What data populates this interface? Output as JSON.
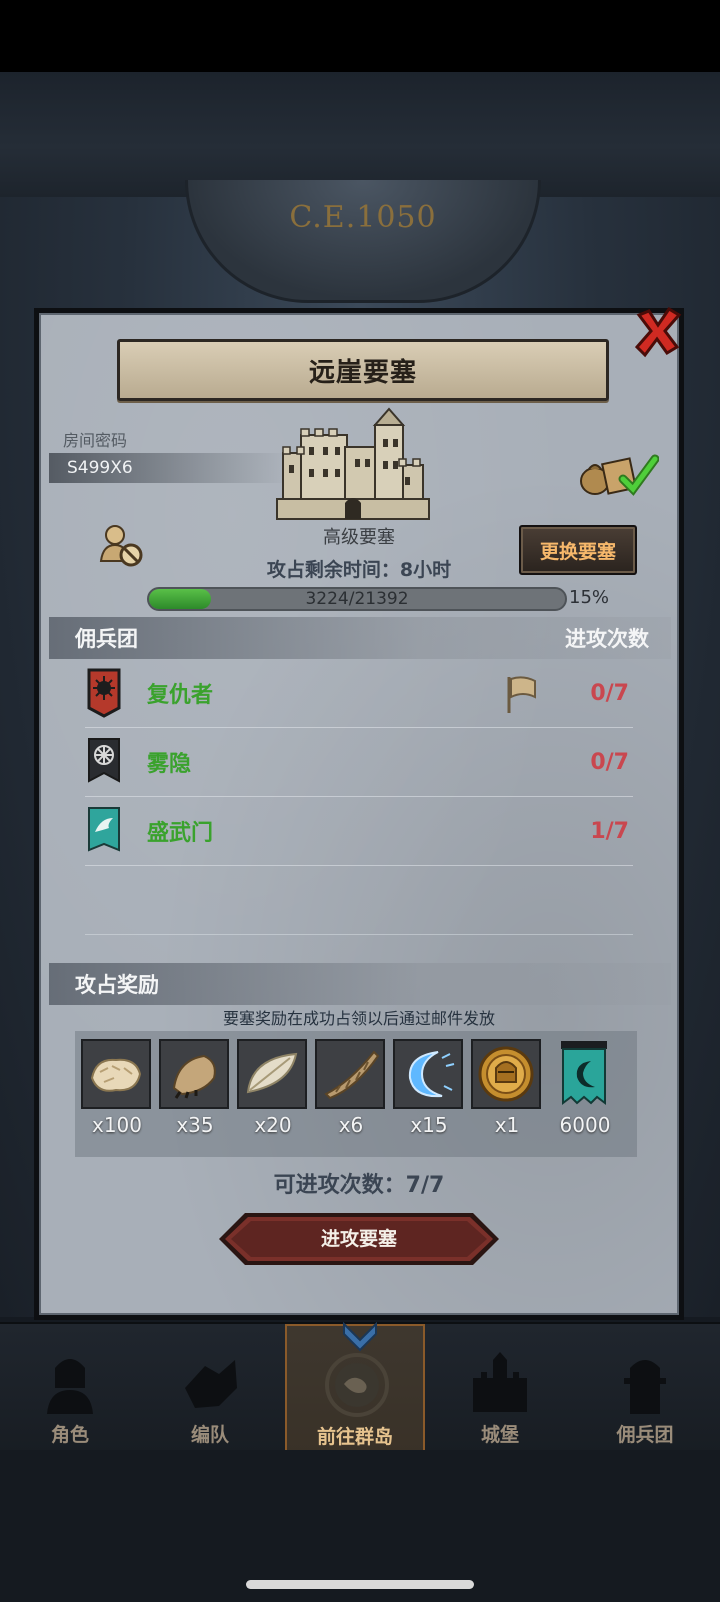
{
  "era": "C.E.1050",
  "dialog": {
    "title": "远崖要塞",
    "room_label": "房间密码",
    "room_code": "S499X6",
    "fort_level": "高级要塞",
    "change_button": "更换要塞",
    "time_remaining": "攻占剩余时间：8小时",
    "progress": {
      "text": "3224/21392",
      "percent_label": "15%",
      "fraction": 0.15
    },
    "mercenary_header": "佣兵团",
    "attack_count_header": "进攻次数",
    "guilds": [
      {
        "name": "复仇者",
        "count": "0/7",
        "emblem_color": "#b5392b",
        "has_flag": true
      },
      {
        "name": "雾隐",
        "count": "0/7",
        "emblem_color": "#2a2c30",
        "has_flag": false
      },
      {
        "name": "盛武门",
        "count": "1/7",
        "emblem_color": "#2fa59c",
        "has_flag": false
      }
    ],
    "reward_header": "攻占奖励",
    "reward_note": "要塞奖励在成功占领以后通过邮件发放",
    "rewards": [
      {
        "icon": "fur-pelt-icon",
        "qty": "x100"
      },
      {
        "icon": "beast-claw-icon",
        "qty": "x35"
      },
      {
        "icon": "feather-plume-icon",
        "qty": "x20"
      },
      {
        "icon": "spiral-horn-icon",
        "qty": "x6"
      },
      {
        "icon": "blue-crescent-icon",
        "qty": "x15"
      },
      {
        "icon": "knight-medal-icon",
        "qty": "x1"
      },
      {
        "icon": "guild-banner-icon",
        "qty": "6000"
      }
    ],
    "attempts": "可进攻次数：7/7",
    "attack_button": "进攻要塞"
  },
  "nav": [
    {
      "label": "角色",
      "icon": "character-icon",
      "active": false
    },
    {
      "label": "编队",
      "icon": "formation-icon",
      "active": false
    },
    {
      "label": "前往群岛",
      "icon": "islands-icon",
      "active": true
    },
    {
      "label": "城堡",
      "icon": "castle-icon",
      "active": false
    },
    {
      "label": "佣兵团",
      "icon": "mercenary-icon",
      "active": false
    }
  ],
  "colors": {
    "accent_orange": "#f6b86b",
    "guild_green": "#3aa22d",
    "count_red": "#c9474f",
    "close_red": "#d02a22"
  }
}
